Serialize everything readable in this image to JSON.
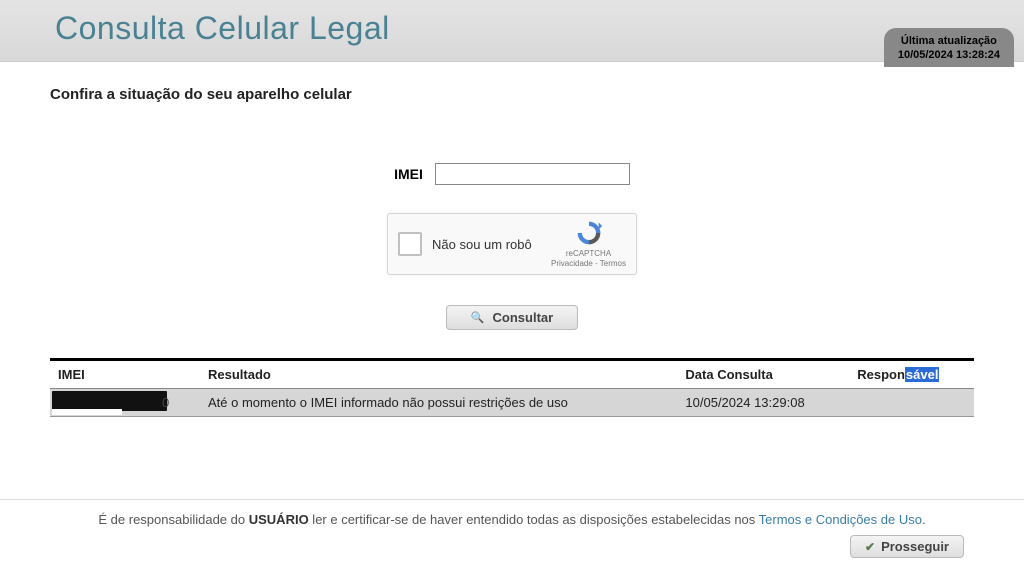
{
  "header": {
    "title": "Consulta Celular Legal",
    "update_label": "Última atualização",
    "update_value": "10/05/2024 13:28:24"
  },
  "subtitle": "Confira a situação do seu aparelho celular",
  "form": {
    "imei_label": "IMEI",
    "imei_value": "",
    "recaptcha_text": "Não sou um robô",
    "recaptcha_brand": "reCAPTCHA",
    "recaptcha_links": "Privacidade - Termos",
    "submit_label": "Consultar"
  },
  "table": {
    "headers": {
      "imei": "IMEI",
      "resultado": "Resultado",
      "data": "Data Consulta",
      "resp_a": "Respon",
      "resp_b": "sável"
    },
    "rows": [
      {
        "imei_tail": "0",
        "resultado": "Até o momento o IMEI informado não possui restrições de uso",
        "data": "10/05/2024 13:29:08",
        "responsavel": ""
      }
    ]
  },
  "footer": {
    "text_a": "É de responsabilidade do ",
    "text_strong": "USUÁRIO",
    "text_b": " ler e certificar-se de haver entendido todas as disposições estabelecidas nos ",
    "link": "Termos e Condições de Uso",
    "dot": ".",
    "proceed": "Prosseguir"
  }
}
